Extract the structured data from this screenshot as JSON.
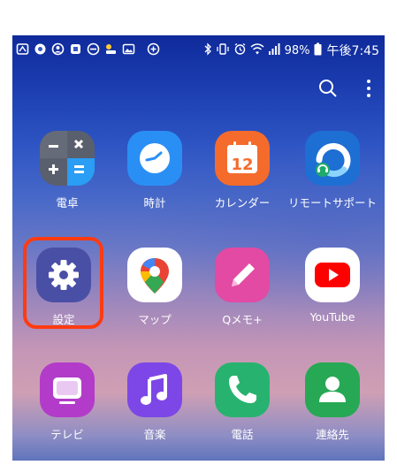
{
  "status_bar": {
    "notification_icons": [
      "app-icon",
      "chrome-icon",
      "account-icon",
      "notification-icon",
      "do-not-disturb-icon",
      "weather-icon",
      "gallery-icon",
      "add-circle-icon"
    ],
    "battery_percent": "98%",
    "time": "午後7:45"
  },
  "top_actions": [
    "search-icon",
    "more-options-icon"
  ],
  "apps": [
    {
      "label": "電卓",
      "icon": "calculator-icon"
    },
    {
      "label": "時計",
      "icon": "clock-icon"
    },
    {
      "label": "カレンダー",
      "icon": "calendar-icon",
      "icon_text": "12"
    },
    {
      "label": "リモートサポート",
      "icon": "remote-support-icon"
    },
    {
      "label": "設定",
      "icon": "gear-icon"
    },
    {
      "label": "マップ",
      "icon": "maps-pin-icon"
    },
    {
      "label": "Qメモ+",
      "icon": "pen-icon"
    },
    {
      "label": "YouTube",
      "icon": "youtube-play-icon"
    },
    {
      "label": "テレビ",
      "icon": "tv-icon"
    },
    {
      "label": "音楽",
      "icon": "music-note-icon"
    },
    {
      "label": "電話",
      "icon": "phone-icon"
    },
    {
      "label": "連絡先",
      "icon": "contact-icon"
    }
  ],
  "highlight_color": "#ff3b12"
}
